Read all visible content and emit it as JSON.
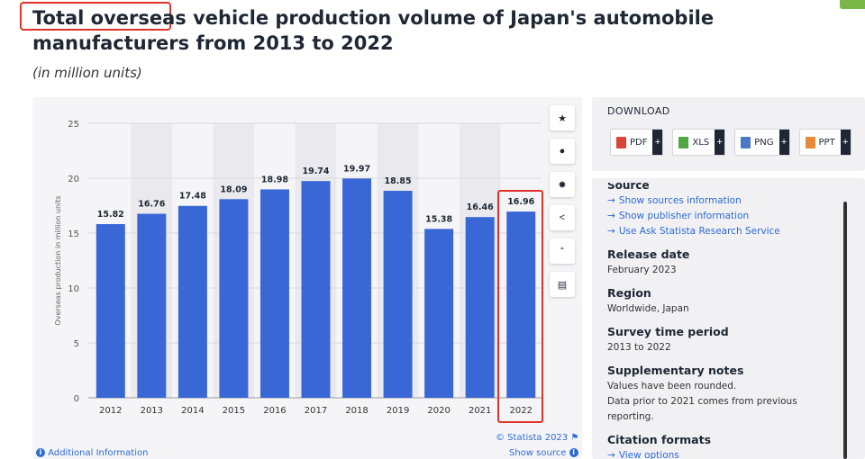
{
  "header": {
    "title": "Total overseas vehicle production volume of Japan's automobile manufacturers from 2013 to 2022",
    "subtitle": "(in million units)"
  },
  "colors": {
    "bar": "#3a67d6",
    "highlight": "#e2332a",
    "link": "#2d6ad8",
    "title": "#1e2733"
  },
  "chart_data": {
    "type": "bar",
    "title": "Total overseas vehicle production volume of Japan's automobile manufacturers from 2013 to 2022",
    "subtitle": "(in million units)",
    "xlabel": "",
    "ylabel": "Overseas production in million units",
    "categories": [
      "2012",
      "2013",
      "2014",
      "2015",
      "2016",
      "2017",
      "2018",
      "2019",
      "2020",
      "2021",
      "2022"
    ],
    "values": [
      15.82,
      16.76,
      17.48,
      18.09,
      18.98,
      19.74,
      19.97,
      18.85,
      15.38,
      16.46,
      16.96
    ],
    "data_labels": [
      "15.82",
      "16.76",
      "17.48",
      "18.09",
      "18.98",
      "19.74",
      "19.97",
      "18.85",
      "15.38",
      "16.46",
      "16.96"
    ],
    "yticks": [
      0,
      5,
      10,
      15,
      20,
      25
    ],
    "ytick_labels": [
      "0",
      "5",
      "10",
      "15",
      "20",
      "25"
    ],
    "ylim": [
      0,
      25
    ],
    "grid": true,
    "legend": "none"
  },
  "chart_footer": {
    "credit": "© Statista 2023",
    "additional_info": "Additional Information",
    "show_source": "Show source"
  },
  "tools": [
    {
      "name": "favorite",
      "icon": "star-icon",
      "glyph": "★"
    },
    {
      "name": "notify",
      "icon": "bell-icon",
      "glyph": "●"
    },
    {
      "name": "settings",
      "icon": "gear-icon",
      "glyph": "✹"
    },
    {
      "name": "share",
      "icon": "share-icon",
      "glyph": "<"
    },
    {
      "name": "cite",
      "icon": "quote-icon",
      "glyph": "“"
    },
    {
      "name": "print",
      "icon": "print-icon",
      "glyph": "▤"
    }
  ],
  "download": {
    "title": "DOWNLOAD",
    "buttons": [
      {
        "label": "PDF",
        "icon": "pdf-file-icon"
      },
      {
        "label": "XLS",
        "icon": "xls-file-icon"
      },
      {
        "label": "PNG",
        "icon": "png-file-icon"
      },
      {
        "label": "PPT",
        "icon": "ppt-file-icon"
      }
    ],
    "plus": "+"
  },
  "info": {
    "source_heading": "Source",
    "links": [
      "Show sources information",
      "Show publisher information",
      "Use Ask Statista Research Service"
    ],
    "release_heading": "Release date",
    "release_value": "February 2023",
    "region_heading": "Region",
    "region_value": "Worldwide, Japan",
    "period_heading": "Survey time period",
    "period_value": "2013 to 2022",
    "notes_heading": "Supplementary notes",
    "notes_line1": "Values have been rounded.",
    "notes_line2": "Data prior to 2021 comes from previous reporting.",
    "citation_heading": "Citation formats",
    "citation_link": "View options"
  }
}
